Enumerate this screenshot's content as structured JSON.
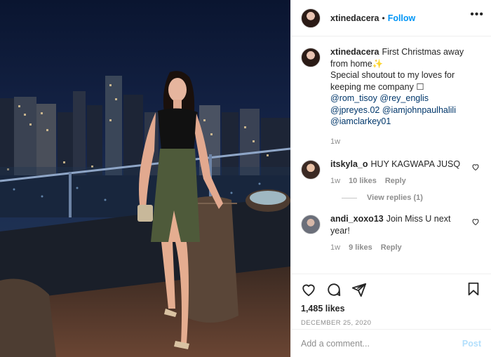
{
  "post": {
    "username": "xtinedacera",
    "follow_label": "Follow",
    "separator": "•",
    "more_icon": "ellipsis-icon"
  },
  "caption": {
    "username": "xtinedacera",
    "line1": "First Christmas away from home",
    "line2": "Special shoutout to my loves for keeping me company",
    "mentions": [
      "@rom_tisoy",
      "@rey_englis",
      "@jpreyes.02",
      "@iamjohnpaulhalili",
      "@iamclarkey01"
    ],
    "time": "1w"
  },
  "comments": [
    {
      "username": "itskyla_o",
      "text": "HUY KAGWAPA JUSQ",
      "time": "1w",
      "likes": "10 likes",
      "reply_label": "Reply",
      "view_replies": "View replies (1)"
    },
    {
      "username": "andi_xoxo13",
      "text": "Join Miss U next year!",
      "time": "1w",
      "likes": "9 likes",
      "reply_label": "Reply"
    }
  ],
  "actions": {
    "likes_count": "1,485 likes",
    "date": "DECEMBER 25, 2020",
    "icons": [
      "heart-icon",
      "comment-icon",
      "share-icon",
      "bookmark-icon"
    ]
  },
  "composer": {
    "placeholder": "Add a comment...",
    "post_label": "Post"
  },
  "colors": {
    "accent": "#0095f6",
    "mention": "#00376b",
    "muted": "#8e8e8e",
    "post_disabled": "#b2dffc"
  }
}
